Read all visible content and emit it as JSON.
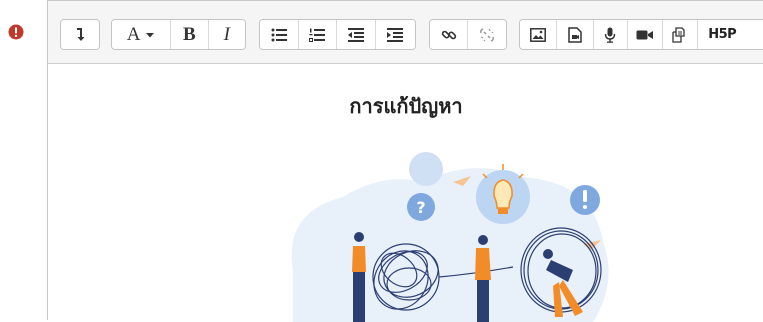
{
  "required_icon": "exclamation-circle-icon",
  "colors": {
    "required": "#c0392b",
    "toolbar_bg": "#f5f5f5",
    "illustration_accent": "#f28c28"
  },
  "toolbar": {
    "expand": {
      "icon": "arrow-down-icon"
    },
    "text": {
      "font_color_label": "A",
      "bold_label": "B",
      "italic_label": "I"
    },
    "lists": [
      "unordered-list-icon",
      "ordered-list-icon",
      "outdent-icon",
      "indent-icon"
    ],
    "links": [
      "link-icon",
      "unlink-icon"
    ],
    "media": [
      "image-icon",
      "media-icon",
      "record-audio-icon",
      "record-video-icon",
      "manage-files-icon"
    ],
    "h5p_label": "H5P"
  },
  "content": {
    "heading": "การแก้ปัญหา",
    "illustration": "problem-solving-illustration"
  }
}
